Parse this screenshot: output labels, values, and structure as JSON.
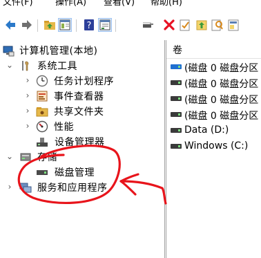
{
  "menu": {
    "items": [
      "文件(F)",
      "操作(A)",
      "查看(V)",
      "帮助(H)"
    ]
  },
  "toolbar": {
    "icons": [
      "back-arrow-icon",
      "forward-arrow-icon",
      "up-folder-icon",
      "show-hide-tree-icon",
      "help-icon",
      "properties-view-icon",
      "connect-drive-icon",
      "delete-icon",
      "check-icon",
      "import-icon",
      "search-icon",
      "export-list-icon"
    ]
  },
  "tree": {
    "root": {
      "label": "计算机管理(本地)"
    },
    "system_tools": {
      "label": "系统工具"
    },
    "task_scheduler": {
      "label": "任务计划程序"
    },
    "event_viewer": {
      "label": "事件查看器"
    },
    "shared_folders": {
      "label": "共享文件夹"
    },
    "performance": {
      "label": "性能"
    },
    "device_manager": {
      "label": "设备管理器"
    },
    "storage": {
      "label": "存储"
    },
    "disk_management": {
      "label": "磁盘管理"
    },
    "services_apps": {
      "label": "服务和应用程序"
    }
  },
  "volumes": {
    "header": "卷",
    "items": [
      {
        "label": "(磁盘 0 磁盘分区",
        "color": "#1f6fd0"
      },
      {
        "label": "(磁盘 0 磁盘分区",
        "color": "#3a3a3a"
      },
      {
        "label": "(磁盘 0 磁盘分区",
        "color": "#3a3a3a"
      },
      {
        "label": "(磁盘 0 磁盘分区",
        "color": "#3a3a3a"
      },
      {
        "label": "Data (D:)",
        "color": "#3a3a3a"
      },
      {
        "label": "Windows (C:)",
        "color": "#3a3a3a"
      }
    ]
  },
  "colors": {
    "annotation": "#e8141b",
    "selection": "#dbe9fb",
    "delete": "#e81123"
  }
}
